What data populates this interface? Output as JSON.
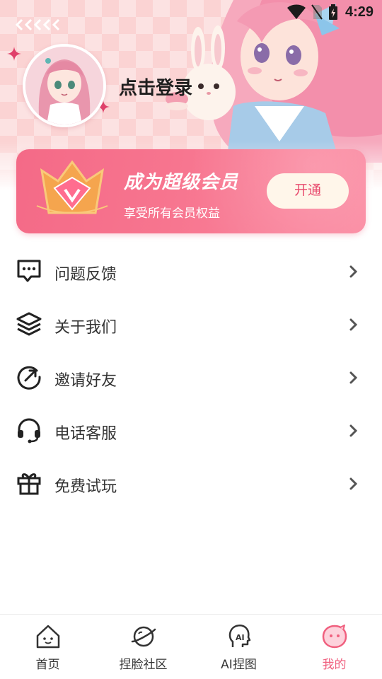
{
  "status_bar": {
    "time": "4:29"
  },
  "profile": {
    "login_prompt": "点击登录"
  },
  "vip_card": {
    "title": "成为超级会员",
    "subtitle": "享受所有会员权益",
    "button_label": "开通",
    "accent": "#f46a87"
  },
  "menu": {
    "items": [
      {
        "label": "问题反馈",
        "icon": "feedback-message-icon"
      },
      {
        "label": "关于我们",
        "icon": "layers-icon"
      },
      {
        "label": "邀请好友",
        "icon": "share-arrow-icon"
      },
      {
        "label": "电话客服",
        "icon": "headset-icon"
      },
      {
        "label": "免费试玩",
        "icon": "gift-icon"
      }
    ]
  },
  "bottom_nav": {
    "tabs": [
      {
        "label": "首页",
        "icon": "home-icon",
        "active": false
      },
      {
        "label": "捏脸社区",
        "icon": "planet-icon",
        "active": false
      },
      {
        "label": "AI捏图",
        "icon": "ai-head-icon",
        "active": false
      },
      {
        "label": "我的",
        "icon": "smiley-bubble-icon",
        "active": true
      }
    ],
    "active_color": "#f0607f"
  }
}
